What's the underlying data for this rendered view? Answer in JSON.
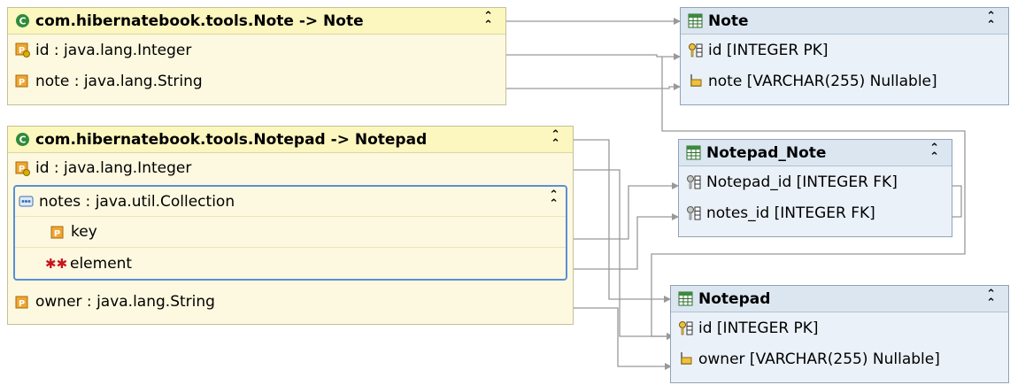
{
  "classes": {
    "note": {
      "title": "com.hibernatebook.tools.Note -> Note",
      "fields": [
        "id : java.lang.Integer",
        "note : java.lang.String"
      ]
    },
    "notepad": {
      "title": "com.hibernatebook.tools.Notepad -> Notepad",
      "id_field": "id : java.lang.Integer",
      "collection": {
        "label": "notes : java.util.Collection",
        "children": [
          "key",
          "element"
        ]
      },
      "owner_field": "owner : java.lang.String"
    }
  },
  "tables": {
    "note": {
      "title": "Note",
      "columns": [
        "id [INTEGER PK]",
        "note [VARCHAR(255) Nullable]"
      ]
    },
    "notepad_note": {
      "title": "Notepad_Note",
      "columns": [
        "Notepad_id [INTEGER FK]",
        "notes_id [INTEGER FK]"
      ]
    },
    "notepad": {
      "title": "Notepad",
      "columns": [
        "id [INTEGER PK]",
        "owner [VARCHAR(255) Nullable]"
      ]
    }
  },
  "ui": {
    "collapse_glyph": "⌃\n⌃"
  },
  "colors": {
    "class_bg": "#fdf9e0",
    "table_bg": "#eaf1f8",
    "connector": "#999999",
    "selection": "#5b8fd6"
  }
}
